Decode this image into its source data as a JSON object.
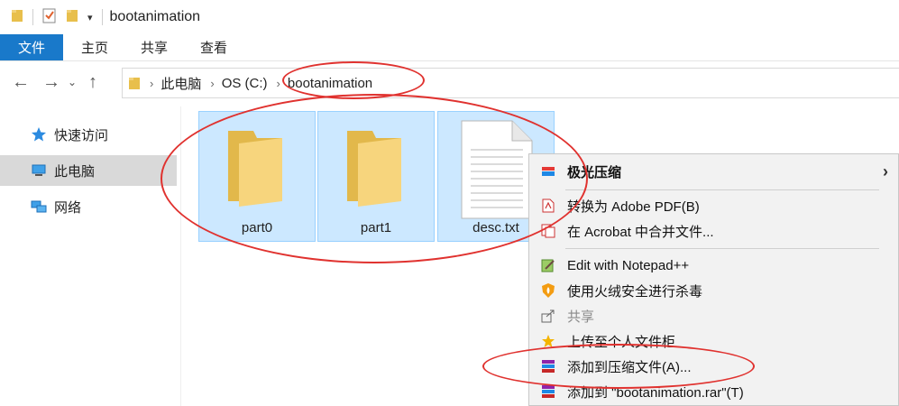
{
  "window": {
    "title": "bootanimation"
  },
  "ribbon": {
    "tabs": [
      "文件",
      "主页",
      "共享",
      "查看"
    ]
  },
  "address": {
    "crumbs": [
      "此电脑",
      "OS (C:)",
      "bootanimation"
    ]
  },
  "sidebar": {
    "items": [
      {
        "label": "快速访问",
        "icon": "star-icon"
      },
      {
        "label": "此电脑",
        "icon": "computer-icon"
      },
      {
        "label": "网络",
        "icon": "network-icon"
      }
    ]
  },
  "files": [
    {
      "name": "part0",
      "type": "folder"
    },
    {
      "name": "part1",
      "type": "folder"
    },
    {
      "name": "desc.txt",
      "type": "text-file"
    }
  ],
  "context_menu": {
    "items": [
      {
        "label": "极光压缩",
        "icon": "jiguang-icon"
      },
      {
        "label": "转换为 Adobe PDF(B)",
        "icon": "pdf-icon"
      },
      {
        "label": "在 Acrobat 中合并文件...",
        "icon": "acrobat-icon"
      },
      {
        "label": "Edit with Notepad++",
        "icon": "notepad-icon"
      },
      {
        "label": "使用火绒安全进行杀毒",
        "icon": "huorong-shield-icon"
      },
      {
        "label": "共享",
        "icon": "share-icon"
      },
      {
        "label": "上传至个人文件柜",
        "icon": "star-upload-icon"
      },
      {
        "label": "添加到压缩文件(A)...",
        "icon": "winrar-icon"
      },
      {
        "label": "添加到 \"bootanimation.rar\"(T)",
        "icon": "winrar-icon"
      }
    ]
  },
  "colors": {
    "accent": "#1979ca",
    "selection": "#cce8ff",
    "annotation": "#e0322f"
  }
}
